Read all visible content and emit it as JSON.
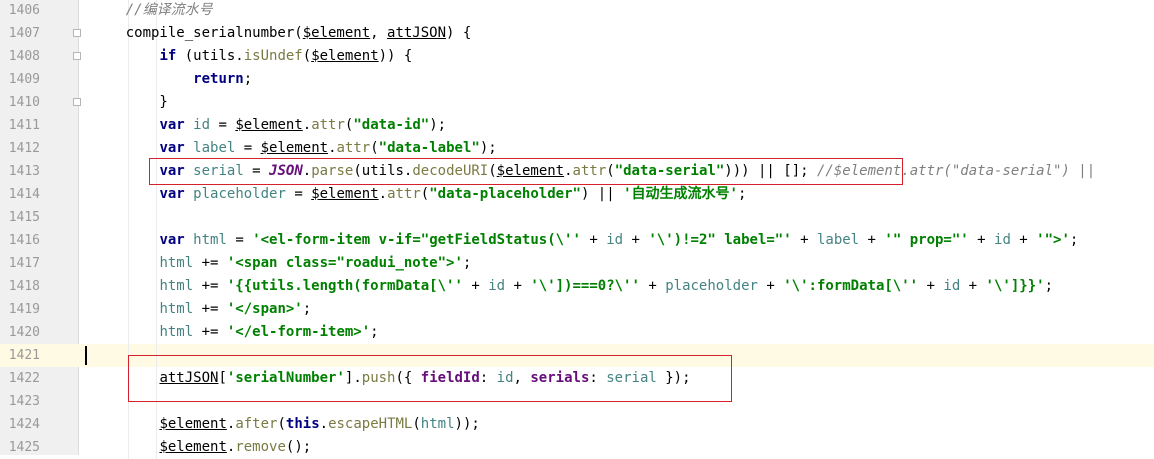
{
  "editor": {
    "lines": [
      {
        "num": "1406",
        "tokens": [
          {
            "t": "    ",
            "c": ""
          },
          {
            "t": "//编译流水号",
            "c": "c"
          }
        ]
      },
      {
        "num": "1407",
        "fold": true,
        "tokens": [
          {
            "t": "    compile_serialnumber(",
            "c": ""
          },
          {
            "t": "$element",
            "c": "u"
          },
          {
            "t": ", ",
            "c": ""
          },
          {
            "t": "attJSON",
            "c": "u"
          },
          {
            "t": ") {",
            "c": ""
          }
        ]
      },
      {
        "num": "1408",
        "fold": true,
        "tokens": [
          {
            "t": "        ",
            "c": ""
          },
          {
            "t": "if",
            "c": "k"
          },
          {
            "t": " (utils.",
            "c": ""
          },
          {
            "t": "isUndef",
            "c": "m"
          },
          {
            "t": "(",
            "c": ""
          },
          {
            "t": "$element",
            "c": "u"
          },
          {
            "t": ")) {",
            "c": ""
          }
        ]
      },
      {
        "num": "1409",
        "tokens": [
          {
            "t": "            ",
            "c": ""
          },
          {
            "t": "return",
            "c": "k"
          },
          {
            "t": ";",
            "c": ""
          }
        ]
      },
      {
        "num": "1410",
        "fold": true,
        "tokens": [
          {
            "t": "        }",
            "c": ""
          }
        ]
      },
      {
        "num": "1411",
        "tokens": [
          {
            "t": "        ",
            "c": ""
          },
          {
            "t": "var",
            "c": "k"
          },
          {
            "t": " ",
            "c": ""
          },
          {
            "t": "id",
            "c": "v"
          },
          {
            "t": " = ",
            "c": ""
          },
          {
            "t": "$element",
            "c": "u"
          },
          {
            "t": ".",
            "c": ""
          },
          {
            "t": "attr",
            "c": "m"
          },
          {
            "t": "(",
            "c": ""
          },
          {
            "t": "\"data-id\"",
            "c": "s"
          },
          {
            "t": ");",
            "c": ""
          }
        ]
      },
      {
        "num": "1412",
        "tokens": [
          {
            "t": "        ",
            "c": ""
          },
          {
            "t": "var",
            "c": "k"
          },
          {
            "t": " ",
            "c": ""
          },
          {
            "t": "label",
            "c": "v"
          },
          {
            "t": " = ",
            "c": ""
          },
          {
            "t": "$element",
            "c": "u"
          },
          {
            "t": ".",
            "c": ""
          },
          {
            "t": "attr",
            "c": "m"
          },
          {
            "t": "(",
            "c": ""
          },
          {
            "t": "\"data-label\"",
            "c": "s"
          },
          {
            "t": ");",
            "c": ""
          }
        ]
      },
      {
        "num": "1413",
        "tokens": [
          {
            "t": "        ",
            "c": ""
          },
          {
            "t": "var",
            "c": "k"
          },
          {
            "t": " ",
            "c": ""
          },
          {
            "t": "serial",
            "c": "v"
          },
          {
            "t": " = ",
            "c": ""
          },
          {
            "t": "JSON",
            "c": "i"
          },
          {
            "t": ".",
            "c": ""
          },
          {
            "t": "parse",
            "c": "m"
          },
          {
            "t": "(utils.",
            "c": ""
          },
          {
            "t": "decodeURI",
            "c": "m"
          },
          {
            "t": "(",
            "c": ""
          },
          {
            "t": "$element",
            "c": "u"
          },
          {
            "t": ".",
            "c": ""
          },
          {
            "t": "attr",
            "c": "m"
          },
          {
            "t": "(",
            "c": ""
          },
          {
            "t": "\"data-serial\"",
            "c": "s"
          },
          {
            "t": "))) || []; ",
            "c": ""
          },
          {
            "t": "//$element.attr(\"data-serial\") ||",
            "c": "c"
          }
        ]
      },
      {
        "num": "1414",
        "tokens": [
          {
            "t": "        ",
            "c": ""
          },
          {
            "t": "var",
            "c": "k"
          },
          {
            "t": " ",
            "c": ""
          },
          {
            "t": "placeholder",
            "c": "v"
          },
          {
            "t": " = ",
            "c": ""
          },
          {
            "t": "$element",
            "c": "u"
          },
          {
            "t": ".",
            "c": ""
          },
          {
            "t": "attr",
            "c": "m"
          },
          {
            "t": "(",
            "c": ""
          },
          {
            "t": "\"data-placeholder\"",
            "c": "s"
          },
          {
            "t": ") || ",
            "c": ""
          },
          {
            "t": "'自动生成流水号'",
            "c": "s"
          },
          {
            "t": ";",
            "c": ""
          }
        ]
      },
      {
        "num": "1415",
        "tokens": []
      },
      {
        "num": "1416",
        "tokens": [
          {
            "t": "        ",
            "c": ""
          },
          {
            "t": "var",
            "c": "k"
          },
          {
            "t": " ",
            "c": ""
          },
          {
            "t": "html",
            "c": "v"
          },
          {
            "t": " = ",
            "c": ""
          },
          {
            "t": "'<el-form-item v-if=\"getFieldStatus(\\''",
            "c": "s"
          },
          {
            "t": " + ",
            "c": ""
          },
          {
            "t": "id",
            "c": "v"
          },
          {
            "t": " + ",
            "c": ""
          },
          {
            "t": "'\\')!=2\" label=\"'",
            "c": "s"
          },
          {
            "t": " + ",
            "c": ""
          },
          {
            "t": "label",
            "c": "v"
          },
          {
            "t": " + ",
            "c": ""
          },
          {
            "t": "'\" prop=\"'",
            "c": "s"
          },
          {
            "t": " + ",
            "c": ""
          },
          {
            "t": "id",
            "c": "v"
          },
          {
            "t": " + ",
            "c": ""
          },
          {
            "t": "'\">'",
            "c": "s"
          },
          {
            "t": ";",
            "c": ""
          }
        ]
      },
      {
        "num": "1417",
        "tokens": [
          {
            "t": "        ",
            "c": ""
          },
          {
            "t": "html",
            "c": "v"
          },
          {
            "t": " += ",
            "c": ""
          },
          {
            "t": "'<span class=\"roadui_note\">'",
            "c": "s"
          },
          {
            "t": ";",
            "c": ""
          }
        ]
      },
      {
        "num": "1418",
        "tokens": [
          {
            "t": "        ",
            "c": ""
          },
          {
            "t": "html",
            "c": "v"
          },
          {
            "t": " += ",
            "c": ""
          },
          {
            "t": "'{{utils.length(formData[\\''",
            "c": "s"
          },
          {
            "t": " + ",
            "c": ""
          },
          {
            "t": "id",
            "c": "v"
          },
          {
            "t": " + ",
            "c": ""
          },
          {
            "t": "'\\'])===0?\\''",
            "c": "s"
          },
          {
            "t": " + ",
            "c": ""
          },
          {
            "t": "placeholder",
            "c": "v"
          },
          {
            "t": " + ",
            "c": ""
          },
          {
            "t": "'\\':formData[\\''",
            "c": "s"
          },
          {
            "t": " + ",
            "c": ""
          },
          {
            "t": "id",
            "c": "v"
          },
          {
            "t": " + ",
            "c": ""
          },
          {
            "t": "'\\']}}'",
            "c": "s"
          },
          {
            "t": ";",
            "c": ""
          }
        ]
      },
      {
        "num": "1419",
        "tokens": [
          {
            "t": "        ",
            "c": ""
          },
          {
            "t": "html",
            "c": "v"
          },
          {
            "t": " += ",
            "c": ""
          },
          {
            "t": "'</span>'",
            "c": "s"
          },
          {
            "t": ";",
            "c": ""
          }
        ]
      },
      {
        "num": "1420",
        "tokens": [
          {
            "t": "        ",
            "c": ""
          },
          {
            "t": "html",
            "c": "v"
          },
          {
            "t": " += ",
            "c": ""
          },
          {
            "t": "'</el-form-item>'",
            "c": "s"
          },
          {
            "t": ";",
            "c": ""
          }
        ]
      },
      {
        "num": "1421",
        "current": true,
        "tokens": []
      },
      {
        "num": "1422",
        "tokens": [
          {
            "t": "        ",
            "c": ""
          },
          {
            "t": "attJSON",
            "c": "u"
          },
          {
            "t": "[",
            "c": ""
          },
          {
            "t": "'serialNumber'",
            "c": "s"
          },
          {
            "t": "].",
            "c": ""
          },
          {
            "t": "push",
            "c": "m"
          },
          {
            "t": "({ ",
            "c": ""
          },
          {
            "t": "fieldId",
            "c": "f"
          },
          {
            "t": ": ",
            "c": ""
          },
          {
            "t": "id",
            "c": "v"
          },
          {
            "t": ", ",
            "c": ""
          },
          {
            "t": "serials",
            "c": "f"
          },
          {
            "t": ": ",
            "c": ""
          },
          {
            "t": "serial",
            "c": "v"
          },
          {
            "t": " });",
            "c": ""
          }
        ]
      },
      {
        "num": "1423",
        "tokens": []
      },
      {
        "num": "1424",
        "tokens": [
          {
            "t": "        ",
            "c": ""
          },
          {
            "t": "$element",
            "c": "u"
          },
          {
            "t": ".",
            "c": ""
          },
          {
            "t": "after",
            "c": "m"
          },
          {
            "t": "(",
            "c": ""
          },
          {
            "t": "this",
            "c": "k"
          },
          {
            "t": ".",
            "c": ""
          },
          {
            "t": "escapeHTML",
            "c": "m"
          },
          {
            "t": "(",
            "c": ""
          },
          {
            "t": "html",
            "c": "v"
          },
          {
            "t": "));",
            "c": ""
          }
        ]
      },
      {
        "num": "1425",
        "tokens": [
          {
            "t": "        ",
            "c": ""
          },
          {
            "t": "$element",
            "c": "u"
          },
          {
            "t": ".",
            "c": ""
          },
          {
            "t": "remove",
            "c": "m"
          },
          {
            "t": "();",
            "c": ""
          }
        ]
      }
    ]
  },
  "colors": {
    "highlight_box": "#d4212b",
    "current_line": "#fffae3",
    "gutter": "#f0f0f0"
  }
}
